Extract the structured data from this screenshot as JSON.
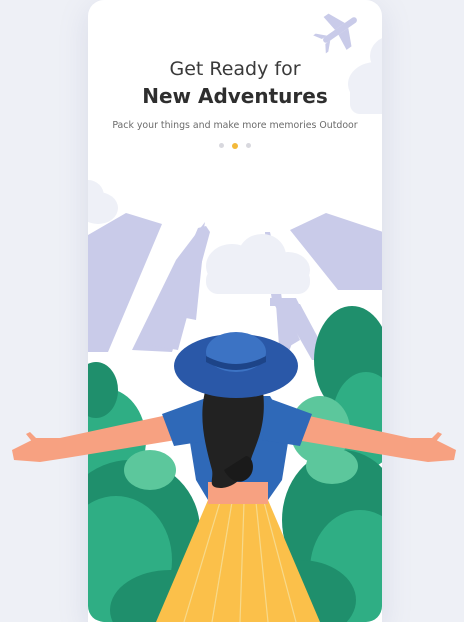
{
  "onboarding": {
    "title_line1": "Get Ready for",
    "title_line2": "New Adventures",
    "subtitle": "Pack your things and make more memories Outdoor",
    "pagination": {
      "total": 3,
      "active_index": 1
    }
  },
  "illustration": {
    "icons": [
      "airplane-icon"
    ],
    "colors": {
      "background": "#eef0f6",
      "card": "#ffffff",
      "buildings": "#c9cbe9",
      "clouds": "#eef0f7",
      "hat": "#2a58a8",
      "shirt": "#2f69b8",
      "hair": "#222222",
      "skin": "#f7a181",
      "skirt": "#fbc04a",
      "bush_dark": "#1f8f6c",
      "bush_mid": "#2fae84",
      "bush_light": "#5cc79c",
      "active_dot": "#f3b93a",
      "inactive_dot": "#d8d8de"
    }
  }
}
